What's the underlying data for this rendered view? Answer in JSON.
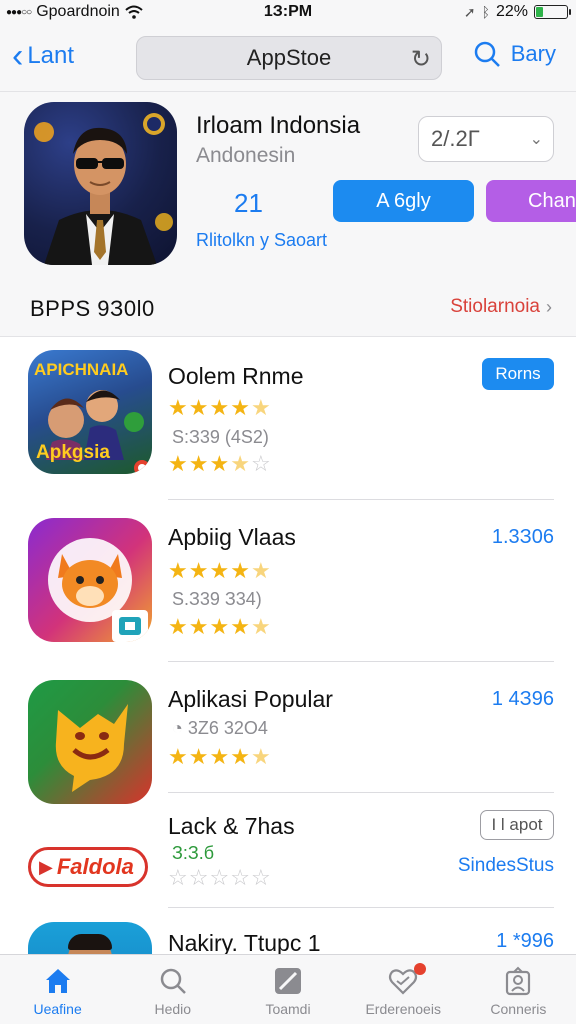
{
  "status_bar": {
    "carrier": "Gpoardnoin",
    "time": "1З:PM",
    "battery": "22%",
    "battery_level": 0.22,
    "battery_color": "#2fb34a"
  },
  "nav": {
    "back_label": "Lant",
    "search_title": "AppStoe",
    "right_label": "Bary"
  },
  "hero": {
    "title": "Irloam Indonsia",
    "subtitle": "Andonesin",
    "select_value": "2/.2Г",
    "count": "21",
    "link": "Rlitolkn y Saoart",
    "primary_button": "A 6gly",
    "secondary_button": "Chan",
    "section_title": "BPPS 9З0l0",
    "section_link": "Stiolarnoia"
  },
  "apps": [
    {
      "name": "Oolem Rnme",
      "meta": "S:З39 (4S2)",
      "rating": 4.5,
      "rating2": 3.5,
      "action": "Rorns",
      "icon_banner_top": "APICHNAIA",
      "icon_banner_bottom": "Apkgsia"
    },
    {
      "name": "Apbiig Vlaas",
      "meta": "S.З39 З34)",
      "rating": 4.5,
      "rating2": 4.5,
      "price": "1.3З06"
    },
    {
      "name": "Aplikasi Popular",
      "meta": "3Z6 32O4",
      "rating": 4.5,
      "price": "1 4З96"
    },
    {
      "name": "Lack & 7has",
      "meta": "З:З.б",
      "rating": 0,
      "action": "I l apot",
      "link": "SindesStus",
      "icon_text": "Faldola"
    },
    {
      "name": "Nakiry. Ttupc 1",
      "price": "1 *996"
    }
  ],
  "tabs": [
    {
      "label": "Ueafine",
      "icon": "home-icon"
    },
    {
      "label": "Hedio",
      "icon": "search-icon"
    },
    {
      "label": "Toamdi",
      "icon": "edit-icon"
    },
    {
      "label": "Erderenoeis",
      "icon": "heart-icon"
    },
    {
      "label": "Conneris",
      "icon": "account-icon"
    }
  ],
  "colors": {
    "accent": "#1c7cf0",
    "star": "#f4b413",
    "purple_button": "#b45ee6",
    "section_link": "#d9423b"
  }
}
